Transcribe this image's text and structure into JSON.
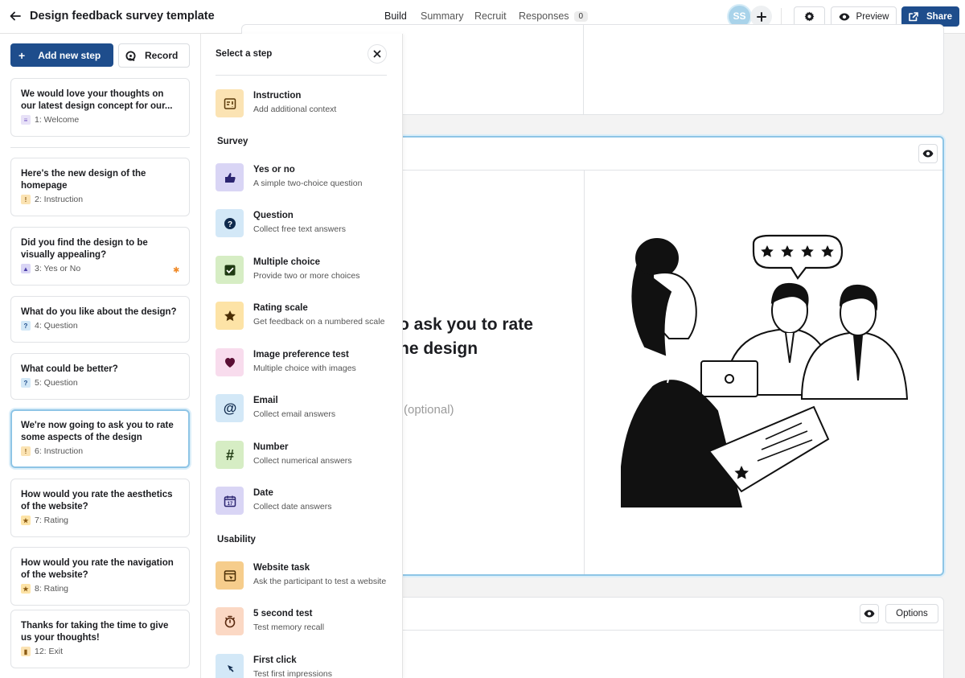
{
  "header": {
    "title": "Design feedback survey template",
    "tabs": [
      {
        "label": "Build"
      },
      {
        "label": "Summary"
      },
      {
        "label": "Recruit"
      },
      {
        "label": "Responses",
        "count": "0"
      }
    ],
    "avatar_initials": "SS",
    "preview_label": "Preview",
    "share_label": "Share"
  },
  "sidebar": {
    "add_step_label": "Add new step",
    "record_label": "Record",
    "steps": [
      {
        "title": "We would love your thoughts on our latest design concept for our...",
        "meta": "1: Welcome"
      },
      {
        "title": "Here's the new design of the homepage",
        "meta": "2: Instruction"
      },
      {
        "title": "Did you find the design to be visually appealing?",
        "meta": "3: Yes or No"
      },
      {
        "title": "What do you like about the design?",
        "meta": "4: Question"
      },
      {
        "title": "What could be better?",
        "meta": "5: Question"
      },
      {
        "title": "We're now going to ask you to rate some aspects of the design",
        "meta": "6: Instruction"
      },
      {
        "title": "How would you rate the aesthetics of the website?",
        "meta": "7: Rating"
      },
      {
        "title": "How would you rate the navigation of the website?",
        "meta": "8: Rating"
      },
      {
        "title": "Thanks for taking the time to give us your thoughts!",
        "meta": "12: Exit"
      }
    ]
  },
  "panel": {
    "title": "Select a step",
    "sections": {
      "survey": "Survey",
      "usability": "Usability"
    },
    "options": [
      {
        "name": "Instruction",
        "desc": "Add additional context"
      },
      {
        "name": "Yes or no",
        "desc": "A simple two-choice question"
      },
      {
        "name": "Question",
        "desc": "Collect free text answers"
      },
      {
        "name": "Multiple choice",
        "desc": "Provide two or more choices"
      },
      {
        "name": "Rating scale",
        "desc": "Get feedback on a numbered scale"
      },
      {
        "name": "Image preference test",
        "desc": "Multiple choice with images"
      },
      {
        "name": "Email",
        "desc": "Collect email answers"
      },
      {
        "name": "Number",
        "desc": "Collect numerical answers"
      },
      {
        "name": "Date",
        "desc": "Collect date answers"
      },
      {
        "name": "Website task",
        "desc": "Ask the participant to test a website"
      },
      {
        "name": "5 second test",
        "desc": "Test memory recall"
      },
      {
        "name": "First click",
        "desc": "Test first impressions"
      }
    ]
  },
  "canvas": {
    "heading_line1": "o ask you to rate",
    "heading_line2": "he design",
    "optional_text": "(optional)",
    "options_label": "Options"
  },
  "colors": {
    "primary": "#1e4d8c",
    "selected_border": "#8ec5e6",
    "instruction_bg": "#fbe3b3",
    "yesno_bg": "#d9d5f5",
    "question_bg": "#d3e8f7",
    "multiple_bg": "#d6edc4",
    "rating_bg": "#fde3a6",
    "image_bg": "#f8dced"
  }
}
